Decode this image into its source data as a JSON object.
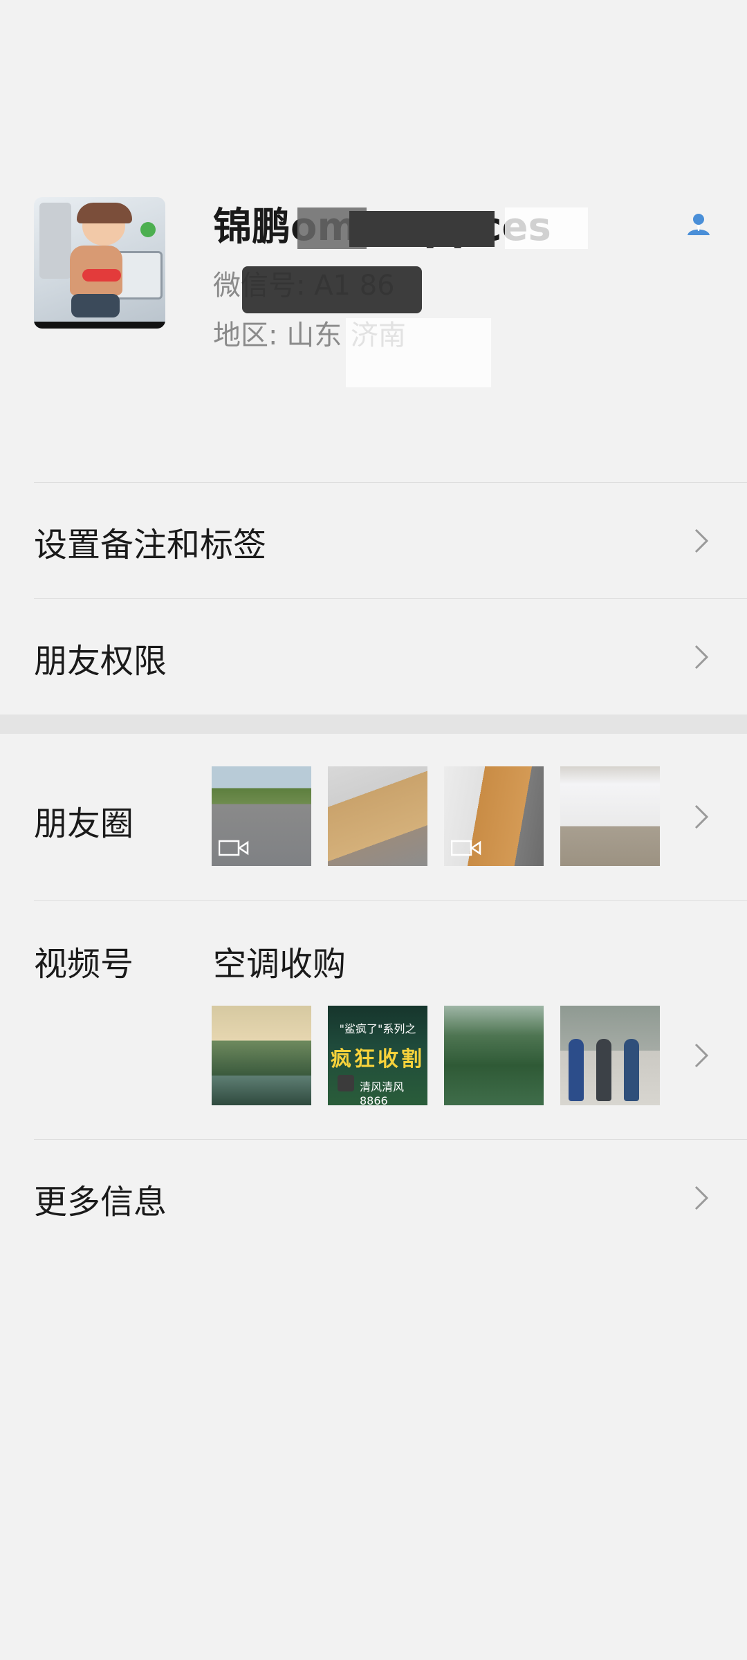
{
  "profile": {
    "nickname": "锦鹏ome appces",
    "wechat_id_label": "微信号: A1 86",
    "region_label": "地区: 山东 济南",
    "contact_icon": "person-icon",
    "accent": "#4a8fd8"
  },
  "menu": {
    "set_remark": "设置备注和标签",
    "friend_permissions": "朋友权限",
    "moments": "朋友圈",
    "channels": "视频号",
    "channels_name": "空调收购",
    "more_info": "更多信息"
  },
  "channel_thumbs": {
    "game_sub": "\"鲨疯了\"系列之",
    "game_title": "疯狂收割",
    "game_foot": "清风清风8866"
  },
  "icons": {
    "chevron": "chevron-right-icon",
    "video": "video-camera-icon"
  }
}
